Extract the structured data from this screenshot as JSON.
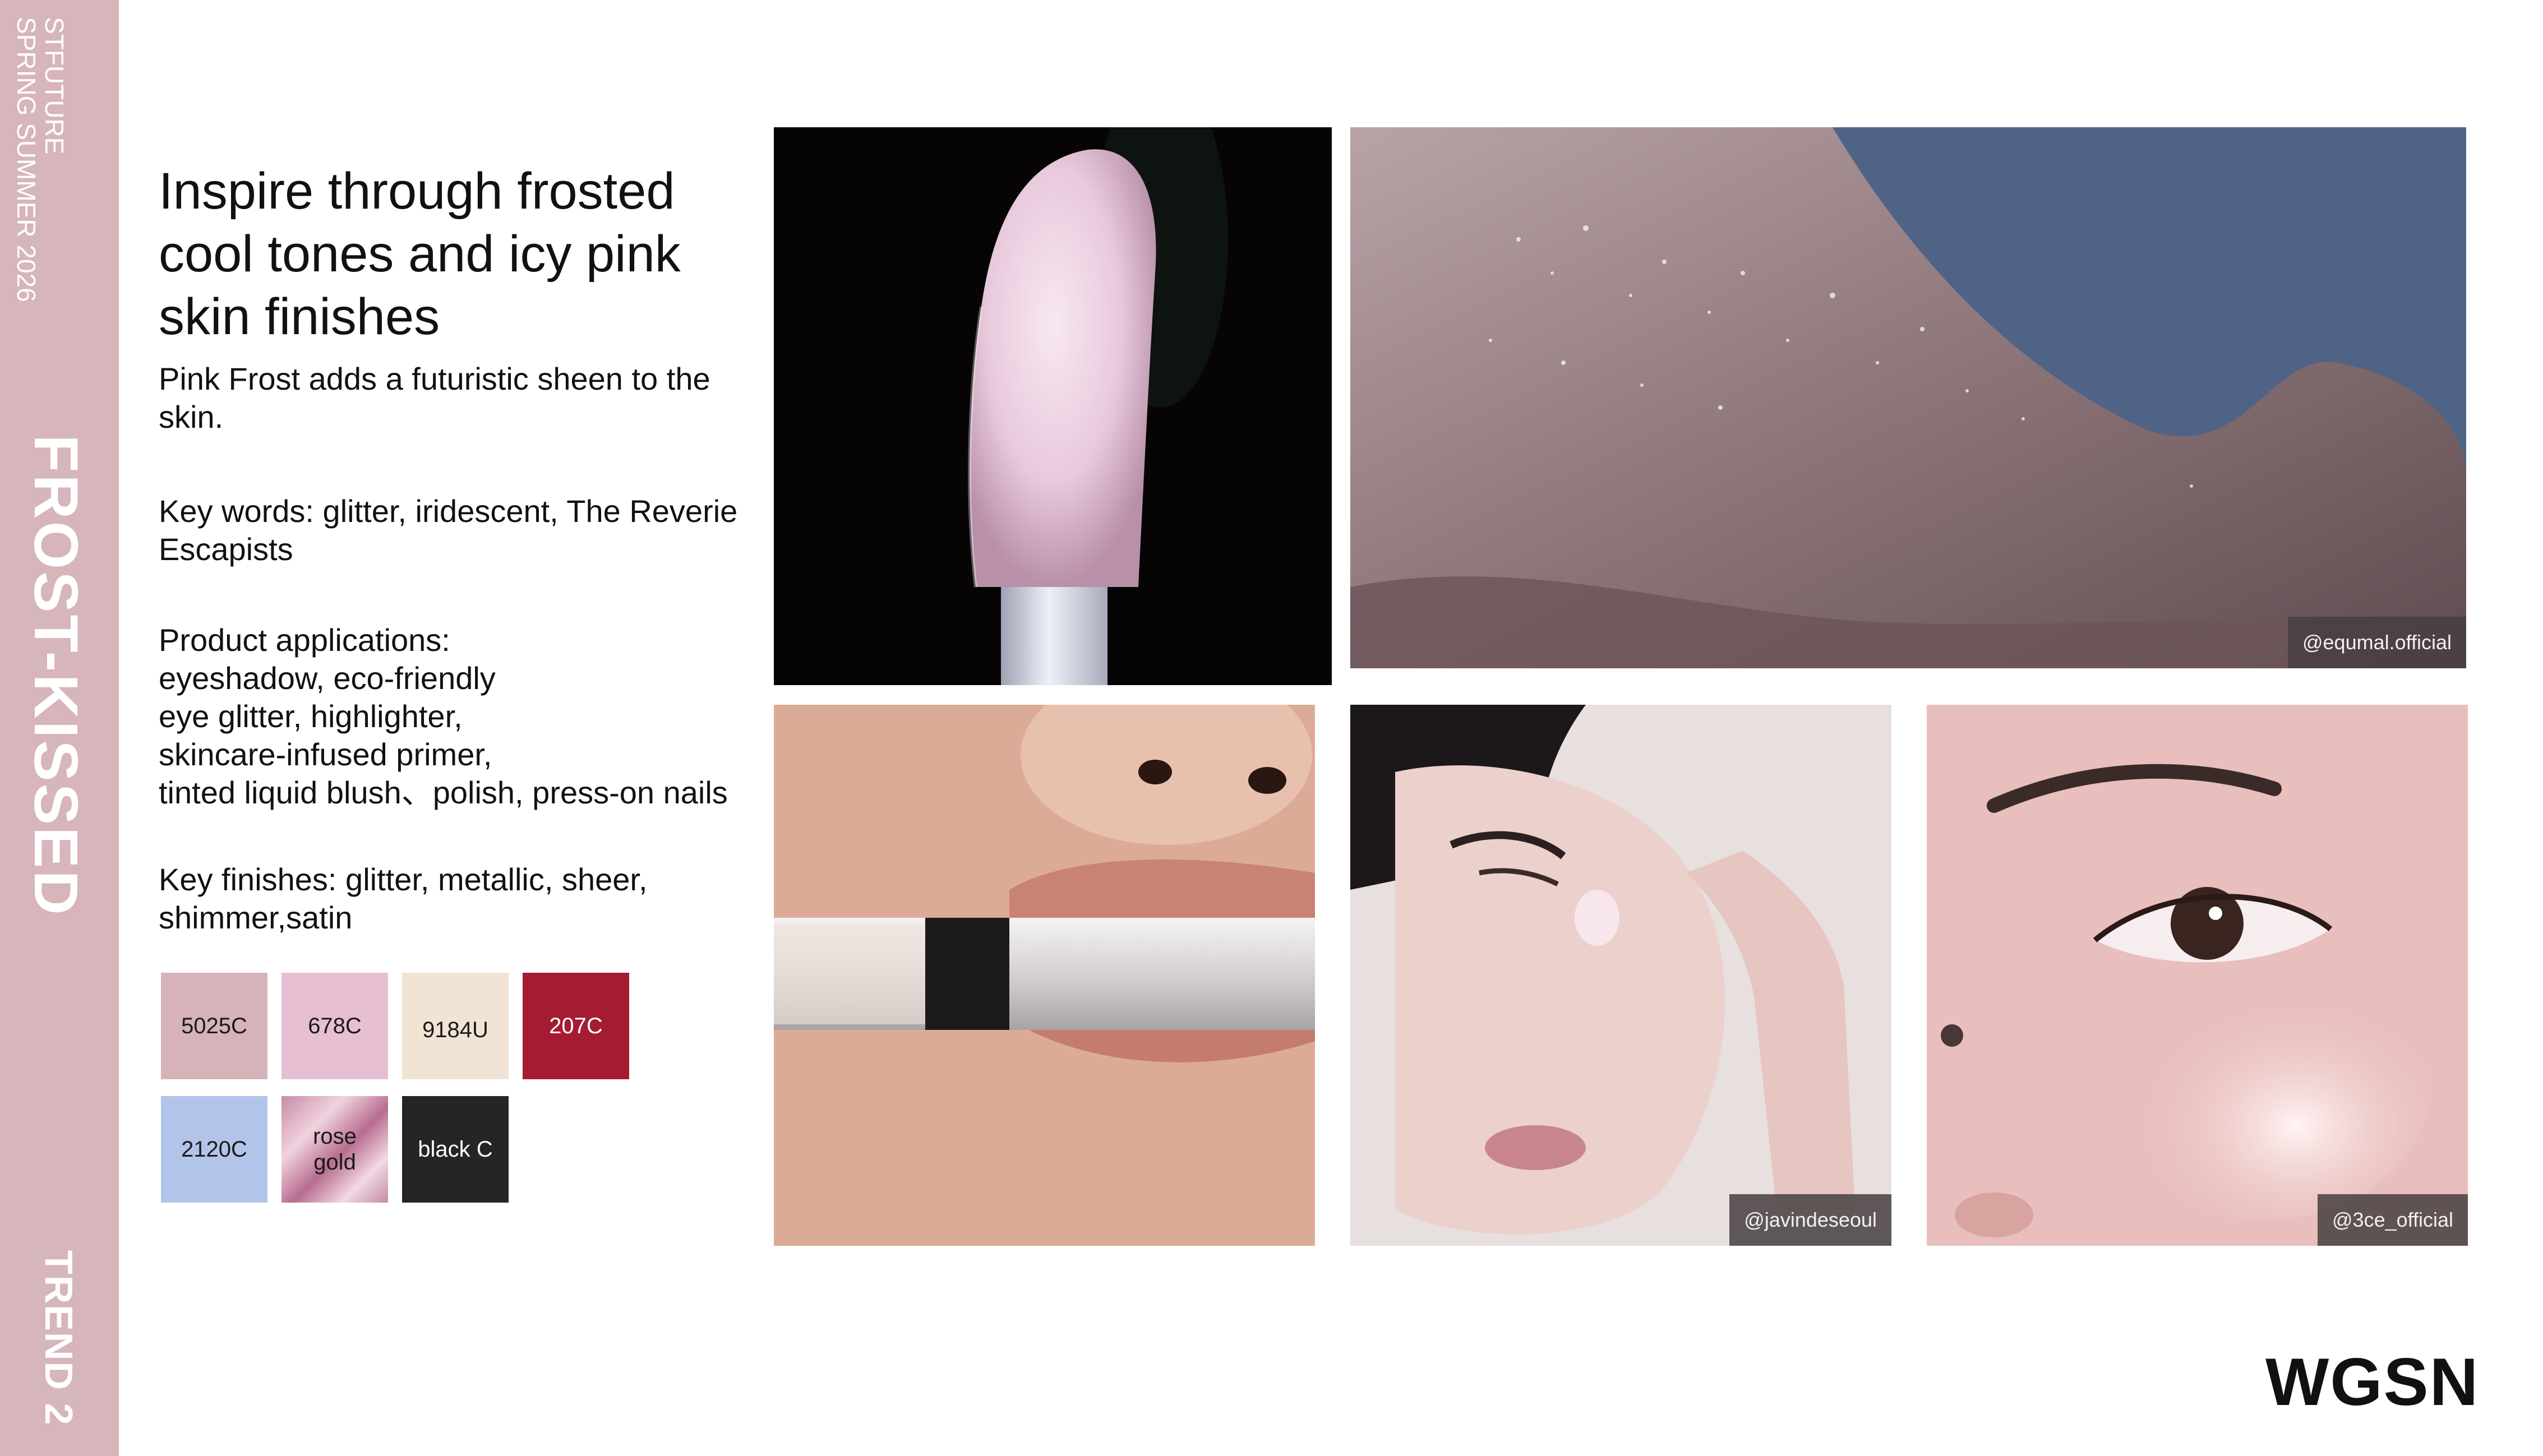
{
  "sidebar": {
    "brand": "STFUTURE",
    "season": "SPRING SUMMER 2026",
    "trend_name": "FROST-KISSED",
    "trend_number": "TREND 2"
  },
  "headline": "Inspire through frosted cool tones and icy pink skin finishes",
  "intro": "Pink Frost adds a futuristic sheen to the skin.",
  "keywords": "Key words: glitter, iridescent, The Reverie Escapists",
  "product_applications": "Product applications:\neyeshadow, eco-friendly\neye glitter, highlighter,\nskincare-infused primer,\ntinted liquid blush、polish, press-on nails",
  "key_finishes": "Key finishes: glitter, metallic, sheer, shimmer,satin",
  "swatches": [
    {
      "label": "5025C",
      "color": "#d6b3b8"
    },
    {
      "label": "678C",
      "color": "#e7bfd3"
    },
    {
      "label": "9184U",
      "color": "#f1e4d4"
    },
    {
      "label": "207C",
      "color": "#a51b32"
    },
    {
      "label": "2120C",
      "color": "#b3c4ea"
    },
    {
      "label": "rose gold",
      "color": "#d9a3bb"
    },
    {
      "label": "black C",
      "color": "#262523"
    }
  ],
  "photos": {
    "lip_gloss_wand": {
      "credit": ""
    },
    "glitter_shoulder": {
      "credit": "@equmal.official"
    },
    "lips_tube": {
      "credit": ""
    },
    "cheek_dot": {
      "credit": "@javindeseoul"
    },
    "glowing_eye": {
      "credit": "@3ce_official"
    }
  },
  "logo": "WGSN"
}
